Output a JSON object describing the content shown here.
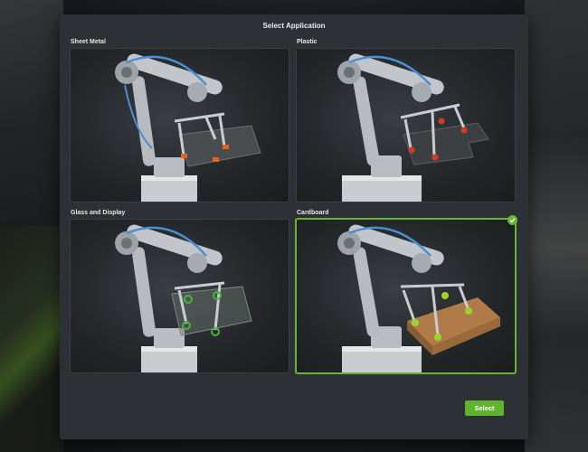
{
  "dialog": {
    "title": "Select Application",
    "select_label": "Select"
  },
  "applications": [
    {
      "label": "Sheet Metal",
      "pad_color": "#e8631c",
      "workpiece": "sheet-metal",
      "selected": false
    },
    {
      "label": "Plastic",
      "pad_color": "#d63a2a",
      "workpiece": "plastic",
      "selected": false
    },
    {
      "label": "Glass and Display",
      "pad_color": "#4bb33a",
      "workpiece": "glass",
      "selected": false
    },
    {
      "label": "Cardboard",
      "pad_color": "#9bd32b",
      "workpiece": "cardboard",
      "selected": true
    }
  ],
  "colors": {
    "accent": "#5fb32e",
    "dialog_bg": "#2d3135",
    "card_bg": "#25282b"
  }
}
